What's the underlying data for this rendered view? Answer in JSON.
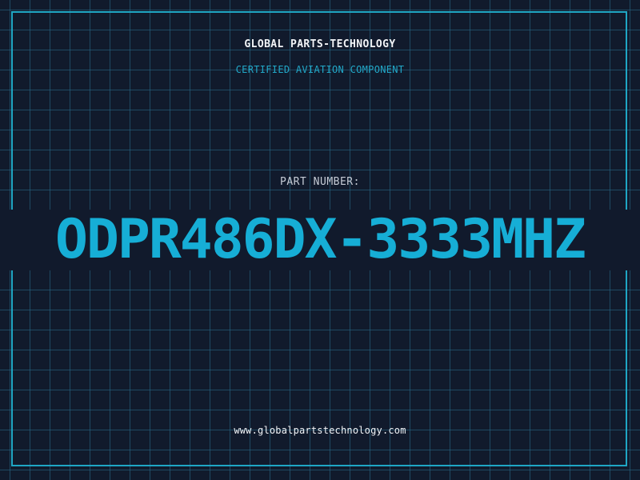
{
  "header": {
    "brand": "GLOBAL PARTS-TECHNOLOGY",
    "subtitle": "CERTIFIED AVIATION COMPONENT"
  },
  "part": {
    "label": "PART NUMBER:",
    "number": "ODPR486DX-3333MHZ"
  },
  "footer": {
    "website": "www.globalpartstechnology.com"
  },
  "colors": {
    "background": "#111a2c",
    "grid": "#2a6e8c",
    "accent": "#16aed6",
    "text": "#f2f4f7"
  }
}
